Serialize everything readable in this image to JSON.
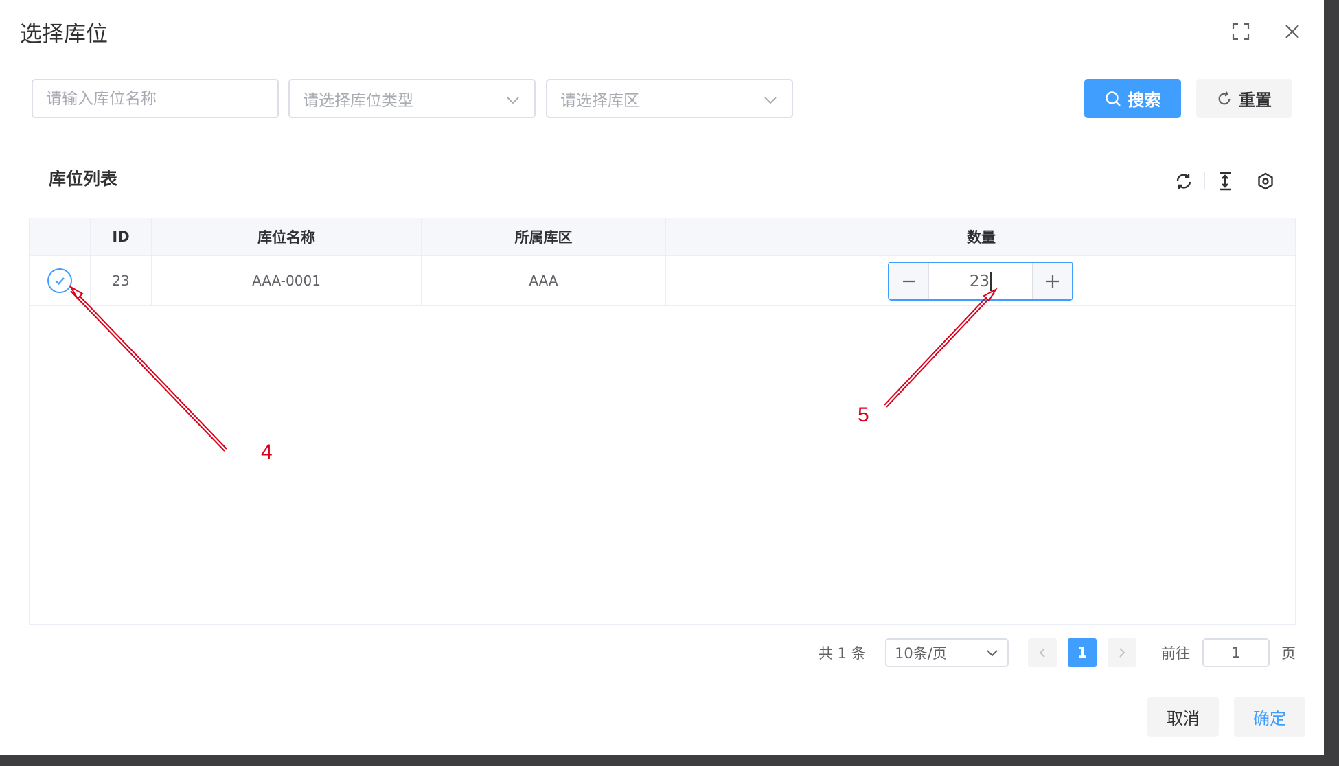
{
  "dialog": {
    "title": "选择库位"
  },
  "filters": {
    "name_placeholder": "请输入库位名称",
    "type_placeholder": "请选择库位类型",
    "area_placeholder": "请选择库区",
    "search_label": "搜索",
    "reset_label": "重置"
  },
  "table": {
    "section_title": "库位列表",
    "columns": [
      "ID",
      "库位名称",
      "所属库区",
      "数量"
    ],
    "rows": [
      {
        "id": "23",
        "name": "AAA-0001",
        "area": "AAA",
        "quantity": "23",
        "selected": true
      }
    ]
  },
  "pagination": {
    "total_text": "共 1 条",
    "page_size": "10条/页",
    "current_page": "1",
    "goto_label": "前往",
    "goto_value": "1",
    "goto_unit": "页"
  },
  "footer": {
    "cancel_label": "取消",
    "confirm_label": "确定"
  },
  "annotations": {
    "marker_checkbox": "4",
    "marker_quantity": "5"
  },
  "colors": {
    "primary": "#409eff",
    "annotation": "#d9001b"
  }
}
